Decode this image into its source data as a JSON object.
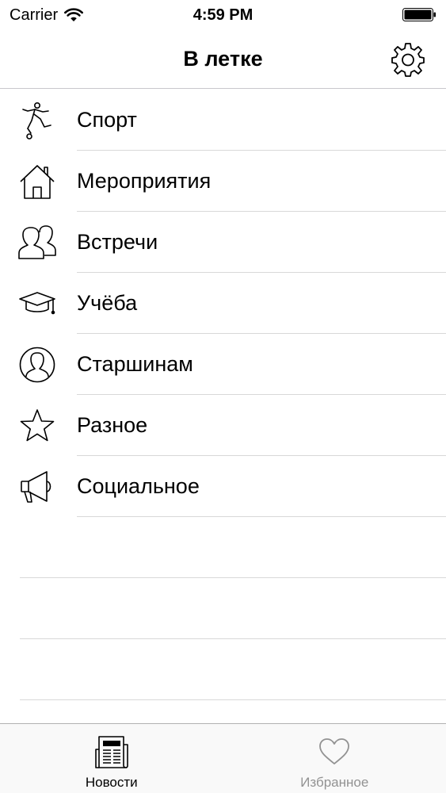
{
  "status_bar": {
    "carrier": "Carrier",
    "time": "4:59 PM"
  },
  "nav": {
    "title": "В летке",
    "settings_icon": "gear-icon"
  },
  "menu": {
    "items": [
      {
        "label": "Спорт",
        "icon": "soccer-player-icon"
      },
      {
        "label": "Мероприятия",
        "icon": "house-icon"
      },
      {
        "label": "Встречи",
        "icon": "people-icon"
      },
      {
        "label": "Учёба",
        "icon": "graduation-cap-icon"
      },
      {
        "label": "Старшинам",
        "icon": "person-circle-icon"
      },
      {
        "label": "Разное",
        "icon": "star-icon"
      },
      {
        "label": "Социальное",
        "icon": "megaphone-icon"
      }
    ]
  },
  "tab_bar": {
    "tabs": [
      {
        "label": "Новости",
        "icon": "newspaper-icon",
        "active": true
      },
      {
        "label": "Избранное",
        "icon": "heart-icon",
        "active": false
      }
    ]
  },
  "colors": {
    "text": "#000000",
    "inactive_tab": "#929292",
    "separator": "#d8d8d8"
  }
}
